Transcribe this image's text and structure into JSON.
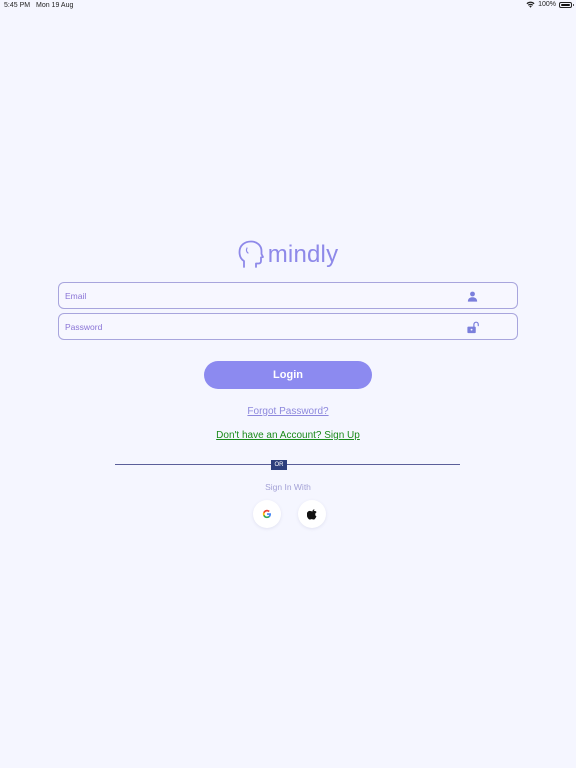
{
  "status_bar": {
    "time": "5:45 PM",
    "date": "Mon 19 Aug",
    "battery": "100%",
    "battery_level": 1.0
  },
  "logo": {
    "text": "mindly",
    "icon": "head-outline-icon",
    "color": "#8e89e9"
  },
  "email": {
    "placeholder": "Email",
    "value": "",
    "icon": "user-icon"
  },
  "password": {
    "placeholder": "Password",
    "value": "",
    "icon": "unlock-icon"
  },
  "login_button": {
    "label": "Login",
    "color": "#8c8af0"
  },
  "forgot_password": "Forgot Password?",
  "sign_up": "Don't have an Account? Sign Up",
  "divider_label": "OR",
  "sign_in_with": "Sign In With",
  "social": [
    {
      "name": "Google",
      "icon": "google-icon"
    },
    {
      "name": "Apple",
      "icon": "apple-icon"
    }
  ]
}
